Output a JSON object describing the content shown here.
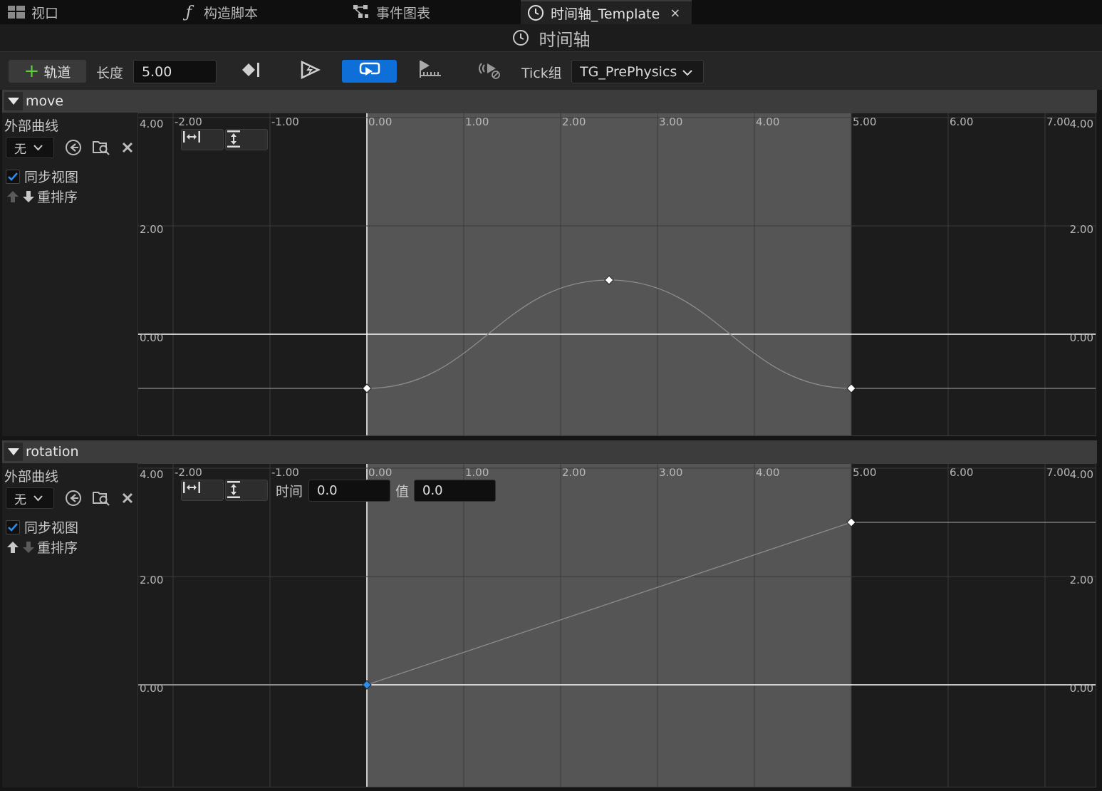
{
  "tabs": [
    {
      "label": "视口",
      "icon": "viewport-icon"
    },
    {
      "label": "构造脚本",
      "icon": "function-icon"
    },
    {
      "label": "事件图表",
      "icon": "event-graph-icon"
    },
    {
      "label": "时间轴_Template",
      "icon": "clock-icon",
      "active": true,
      "close": "×"
    }
  ],
  "title": "时间轴",
  "toolbar": {
    "add_track_label": "轨道",
    "length_label": "长度",
    "length_value": "5.00",
    "tick_group_label": "Tick组",
    "tick_group_value": "TG_PrePhysics",
    "icons": [
      "add-key-icon",
      "autoplay-icon",
      "loop-icon",
      "use-last-keyframe-icon",
      "replicated-icon"
    ]
  },
  "colors": {
    "accent": "#0e6fd8",
    "add_green": "#5fcf3c",
    "selected_key": "#2b8ef0"
  },
  "tracks": [
    {
      "name": "move",
      "side": {
        "external_curve_label": "外部曲线",
        "curve_select_value": "无",
        "sync_view_label": "同步视图",
        "sync_view_checked": true,
        "reorder_label": "重排序"
      },
      "x_ticks": [
        "-2.00",
        "-1.00",
        "0.00",
        "1.00",
        "2.00",
        "3.00",
        "4.00",
        "5.00",
        "6.00",
        "7.00"
      ],
      "y_ticks": [
        "4.00",
        "2.00",
        "0.00"
      ],
      "keys": [
        {
          "time": 0.0,
          "value": -1.0
        },
        {
          "time": 2.5,
          "value": 1.0
        },
        {
          "time": 5.0,
          "value": -1.0
        }
      ],
      "interp": "cubic",
      "show_key_editor": false
    },
    {
      "name": "rotation",
      "side": {
        "external_curve_label": "外部曲线",
        "curve_select_value": "无",
        "sync_view_label": "同步视图",
        "sync_view_checked": true,
        "reorder_label": "重排序"
      },
      "x_ticks": [
        "-2.00",
        "-1.00",
        "0.00",
        "1.00",
        "2.00",
        "3.00",
        "4.00",
        "5.00",
        "6.00",
        "7.00"
      ],
      "y_ticks": [
        "4.00",
        "2.00",
        "0.00"
      ],
      "keys": [
        {
          "time": 0.0,
          "value": 0.0,
          "selected": true
        },
        {
          "time": 5.0,
          "value": 3.0
        }
      ],
      "interp": "linear",
      "show_key_editor": true,
      "key_editor": {
        "time_label": "时间",
        "time_value": "0.0",
        "value_label": "值",
        "value_value": "0.0"
      }
    }
  ]
}
